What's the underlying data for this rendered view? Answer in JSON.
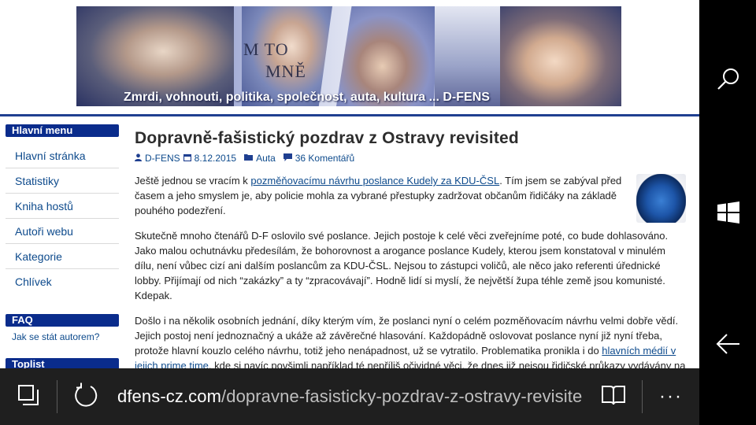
{
  "banner": {
    "logo_text_line1": "M TO",
    "logo_text_line2": "MNĚ",
    "tagline": "Zmrdi, vohnouti, politika, společnost, auta, kultura ... D-FENS"
  },
  "sidebar": {
    "main_menu_title": "Hlavní menu",
    "items": [
      {
        "label": "Hlavní stránka"
      },
      {
        "label": "Statistiky"
      },
      {
        "label": "Kniha hostů"
      },
      {
        "label": "Autoři webu"
      },
      {
        "label": "Kategorie"
      },
      {
        "label": "Chlívek"
      }
    ],
    "faq_title": "FAQ",
    "faq_link": "Jak se stát autorem?",
    "toplist_title": "Toplist"
  },
  "article": {
    "title": "Dopravně-fašistický pozdrav z Ostravy revisited",
    "author": "D-FENS",
    "date": "8.12.2015",
    "category": "Auta",
    "comments": "36 Komentářů",
    "p1_before": "Ještě jednou se vracím k ",
    "p1_link": "pozměňovacímu návrhu poslance Kudely za KDU-ČSL",
    "p1_after": ". Tím jsem se zabýval před časem a jeho smyslem je, aby policie mohla za vybrané přestupky zadržovat občanům řidičáky na základě pouhého podezření.",
    "p2": "Skutečně mnoho čtenářů D-F oslovilo své poslance. Jejich postoje k celé věci zveřejníme poté, co bude dohlasováno. Jako malou ochutnávku předesílám, že bohorovnost a arogance poslance Kudely, kterou jsem konstatoval v minulém dílu, není vůbec cizí ani dalším poslancům za KDU-ČSL. Nejsou to zástupci voličů, ale něco jako referenti úřednické lobby. Přijímají od nich “zakázky” a ty “zpracovávají”. Hodně lidí si myslí, že největší župa téhle země jsou komunisté. Kdepak.",
    "p3_before": "Došlo i na několik osobních jednání, díky kterým vím, že poslanci nyní o celém pozměňovacím návrhu velmi dobře vědí. Jejich postoj není jednoznačný a ukáže až závěrečné hlasování. Každopádně oslovovat poslance nyní již nyní třeba, protože hlavní kouzlo celého návrhu, totiž jeho nenápadnost, už se vytratilo. Problematika pronikla i do ",
    "p3_link": "hlavních médií v jejich prime time",
    "p3_after": ", kde si navíc povšimli například té nepříliš očividné věci, že dnes již nejsou řidičské průkazy vydávány na dobu neurčitou, ale na deset let."
  },
  "browser": {
    "url_domain": "dfens-cz.com",
    "url_path": "/dopravne-fasisticky-pozdrav-z-ostravy-revisite",
    "more_label": "···"
  },
  "icons": {
    "search": "search-icon",
    "windows": "windows-icon",
    "back": "back-arrow-icon",
    "tabs": "tabs-icon",
    "refresh": "refresh-icon",
    "reading": "reading-view-icon"
  },
  "colors": {
    "accent": "#0a2c8c",
    "link": "#0d4a8c",
    "bar": "#1f1f1f"
  }
}
